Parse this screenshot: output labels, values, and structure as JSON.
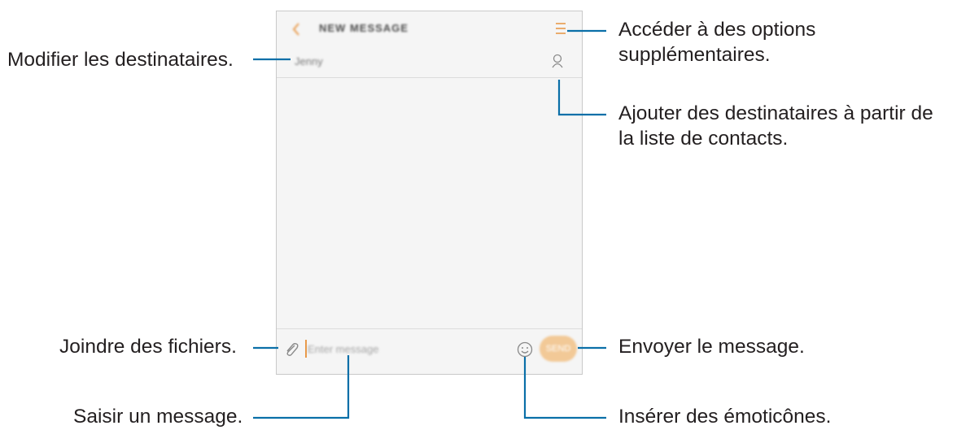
{
  "screen": {
    "header": {
      "back_icon": "chevron-left-icon",
      "title": "NEW MESSAGE",
      "menu_icon": "menu-icon"
    },
    "recipient": {
      "name": "Jenny",
      "contact_icon": "contact-person-icon"
    },
    "compose": {
      "attach_icon": "paperclip-icon",
      "placeholder": "Enter message",
      "emoji_icon": "smiley-icon",
      "send_label": "SEND"
    },
    "accent_color": "#e89a4b",
    "send_button_color": "#f2c997"
  },
  "callouts": {
    "more_options": [
      "Accéder à des options",
      "supplémentaires."
    ],
    "edit_recipients": "Modifier les destinataires.",
    "add_from_contacts": [
      "Ajouter des destinataires à partir de",
      "la liste de contacts."
    ],
    "attach_files": "Joindre des fichiers.",
    "send_message": "Envoyer le message.",
    "enter_message": "Saisir un message.",
    "insert_emoticons": "Insérer des émoticônes."
  },
  "leader_color": "#0a6fa8"
}
